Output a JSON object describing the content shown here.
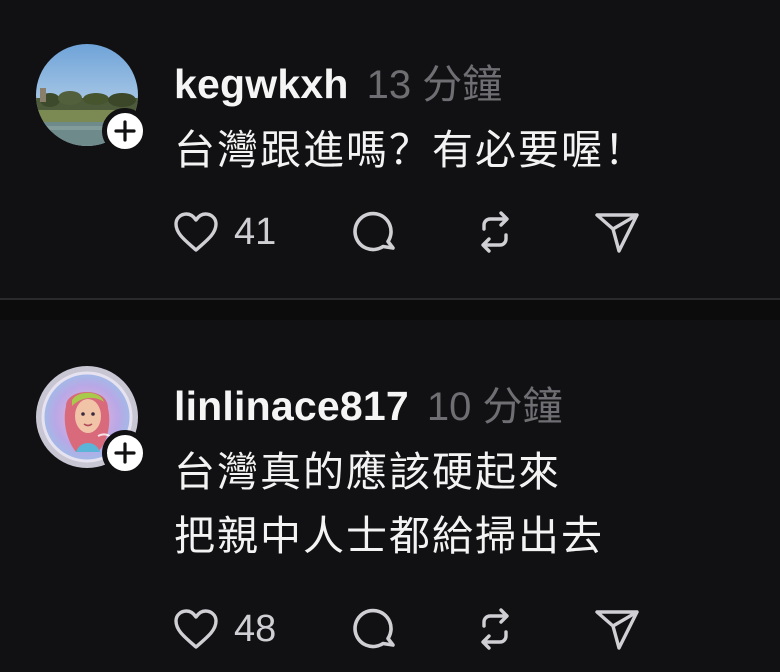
{
  "posts": [
    {
      "username": "kegwkxh",
      "timestamp": "13 分鐘",
      "text_lines": [
        "台灣跟進嗎？有必要喔！"
      ],
      "likes": "41",
      "avatar": "park-lake-photo"
    },
    {
      "username": "linlinace817",
      "timestamp": "10 分鐘",
      "text_lines": [
        "台灣真的應該硬起來",
        "把親中人士都給掃出去"
      ],
      "likes": "48",
      "avatar": "illustrated-portrait"
    }
  ],
  "icons": {
    "follow": "plus-icon",
    "like": "heart-icon",
    "comment": "comment-bubble-icon",
    "repost": "repost-icon",
    "share": "send-icon"
  },
  "colors": {
    "background": "#111113",
    "text": "#f3f3f3",
    "timestamp": "#6e6e73",
    "icon": "#d0d0d4"
  }
}
